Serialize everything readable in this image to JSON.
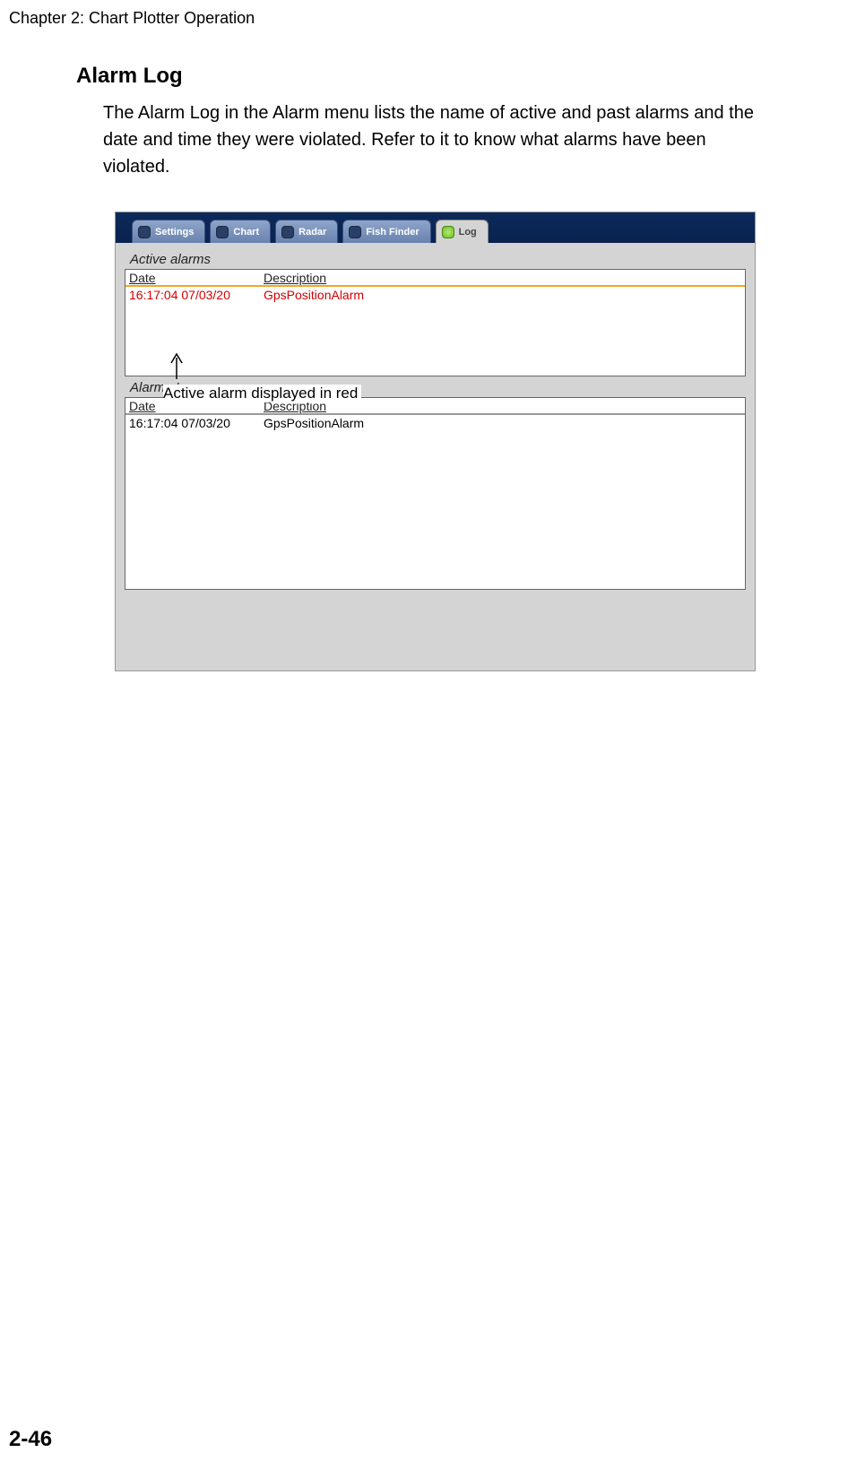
{
  "chapter": "Chapter 2: Chart Plotter Operation",
  "section_title": "Alarm Log",
  "body": "The Alarm Log in the Alarm menu lists the name of active and past alarms and the date and time they were violated. Refer to it to know what alarms have been violated.",
  "tabs": {
    "settings": "Settings",
    "chart": "Chart",
    "radar": "Radar",
    "fishfinder": "Fish Finder",
    "log": "Log"
  },
  "active_section": {
    "label": "Active alarms",
    "headers": {
      "date": "Date",
      "desc": "Description"
    },
    "row": {
      "date": "16:17:04 07/03/20",
      "desc": "GpsPositionAlarm"
    }
  },
  "annotation": "Active alarm displayed in red",
  "log_section": {
    "label": "Alarms Log",
    "headers": {
      "date": "Date",
      "desc": "Description"
    },
    "row": {
      "date": "16:17:04 07/03/20",
      "desc": "GpsPositionAlarm"
    }
  },
  "page_number": "2-46"
}
